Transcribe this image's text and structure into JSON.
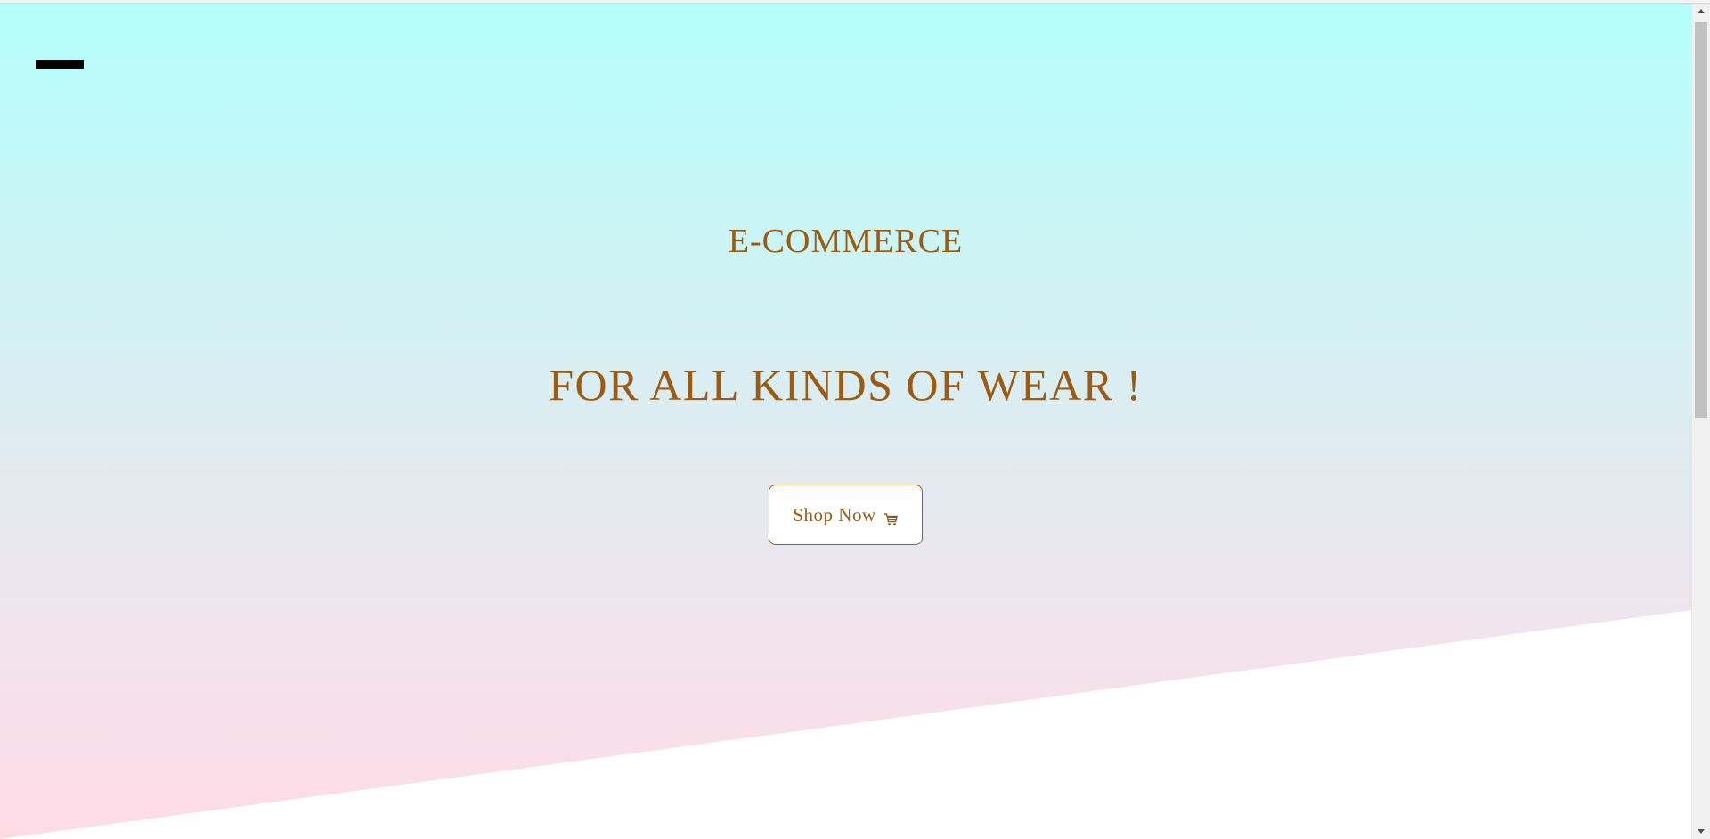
{
  "header": {
    "menu_icon": "menu-icon"
  },
  "hero": {
    "title": "E-COMMERCE",
    "subtitle": "FOR ALL KINDS OF WEAR !",
    "cta_label": "Shop Now",
    "cta_icon": "cart-icon",
    "gradient_colors": [
      "#b3fffa",
      "#ffdbe6"
    ],
    "text_color": "#9b5b12"
  },
  "scrollbar": {
    "up_icon": "scroll-up-arrow-icon",
    "down_icon": "scroll-down-arrow-icon"
  }
}
